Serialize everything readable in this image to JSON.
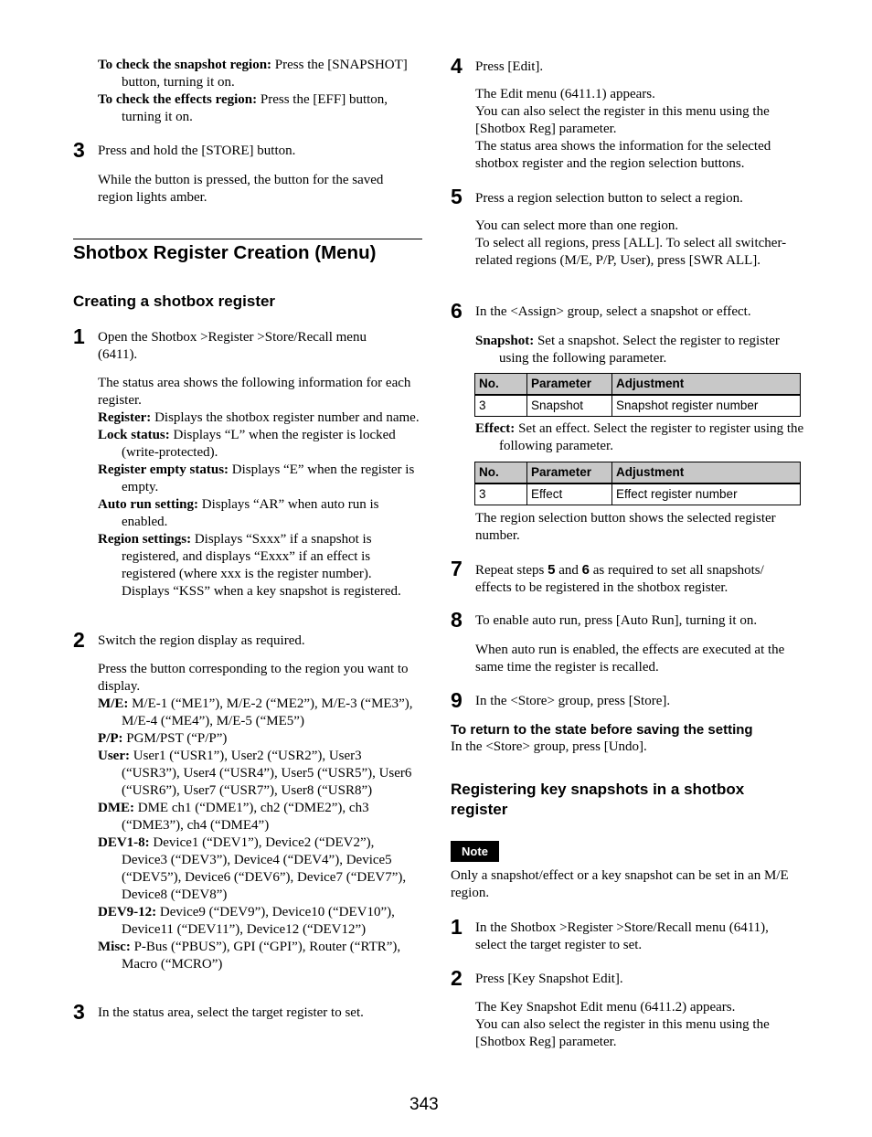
{
  "left_column": {
    "intro_items": [
      {
        "label": "To check the snapshot region:",
        "text": " Press the [SNAPSHOT] button, turning it on."
      },
      {
        "label": "To check the effects region:",
        "text": " Press the [EFF] button, turning it on."
      }
    ],
    "prev_step3": {
      "number": "3",
      "text": "Press and hold the [STORE] button.",
      "detail": "While the button is pressed, the button for the saved region lights amber."
    },
    "section_title": "Shotbox Register Creation (Menu)",
    "subsection_title": "Creating a shotbox register",
    "step1": {
      "number": "1",
      "text": "Open the Shotbox >Register >Store/Recall menu (6411).",
      "detail": "The status area shows the following information for each register.",
      "items": [
        {
          "label": "Register:",
          "text": " Displays the shotbox register number and name."
        },
        {
          "label": "Lock status:",
          "text": " Displays “L” when the register is locked (write-protected)."
        },
        {
          "label": "Register empty status:",
          "text": " Displays “E” when the register is empty."
        },
        {
          "label": "Auto run setting:",
          "text": " Displays “AR” when auto run is enabled."
        },
        {
          "label": "Region settings:",
          "text": " Displays “Sxxx” if a snapshot is registered, and displays “Exxx” if an effect is registered (where xxx is the register number). Displays “KSS” when a key snapshot is registered."
        }
      ]
    },
    "step2": {
      "number": "2",
      "text": "Switch the region display as required.",
      "detail": "Press the button corresponding to the region you want to display.",
      "items": [
        {
          "label": "M/E:",
          "text": " M/E-1 (“ME1”), M/E-2 (“ME2”), M/E-3 (“ME3”), M/E-4 (“ME4”), M/E-5 (“ME5”)"
        },
        {
          "label": "P/P:",
          "text": " PGM/PST (“P/P”)"
        },
        {
          "label": "User:",
          "text": " User1 (“USR1”), User2 (“USR2”), User3 (“USR3”), User4 (“USR4”), User5 (“USR5”), User6 (“USR6”), User7 (“USR7”), User8 (“USR8”)"
        },
        {
          "label": "DME:",
          "text": " DME ch1 (“DME1”), ch2 (“DME2”), ch3 (“DME3”), ch4 (“DME4”)"
        },
        {
          "label": "DEV1-8:",
          "text": " Device1 (“DEV1”), Device2 (“DEV2”), Device3 (“DEV3”), Device4 (“DEV4”), Device5 (“DEV5”), Device6 (“DEV6”), Device7 (“DEV7”), Device8 (“DEV8”)"
        },
        {
          "label": "DEV9-12:",
          "text": " Device9 (“DEV9”), Device10 (“DEV10”), Device11 (“DEV11”), Device12 (“DEV12”)"
        },
        {
          "label": "Misc:",
          "text": " P-Bus (“PBUS”), GPI (“GPI”), Router (“RTR”), Macro (“MCRO”)"
        }
      ]
    },
    "step3": {
      "number": "3",
      "text": "In the status area, select the target register to set."
    }
  },
  "right_column": {
    "step4": {
      "number": "4",
      "text": "Press [Edit].",
      "detail_lines": [
        "The Edit menu (6411.1) appears.",
        "You can also select the register in this menu using the [Shotbox Reg] parameter.",
        "The status area shows the information for the selected shotbox register and the region selection buttons."
      ]
    },
    "step5": {
      "number": "5",
      "text": "Press a region selection button to select a region.",
      "detail_lines": [
        "You can select more than one region.",
        "To select all regions, press [ALL]. To select all switcher-related regions (M/E, P/P, User), press [SWR ALL]."
      ]
    },
    "step6": {
      "number": "6",
      "text": "In the <Assign> group, select a snapshot or effect.",
      "snapshot": {
        "label": "Snapshot:",
        "text": " Set a snapshot. Select the register to register using the following parameter."
      },
      "snapshot_table": {
        "headers": [
          "No.",
          "Parameter",
          "Adjustment"
        ],
        "rows": [
          [
            "3",
            "Snapshot",
            "Snapshot register number"
          ]
        ]
      },
      "effect": {
        "label": "Effect:",
        "text": " Set an effect. Select the register to register using the following parameter."
      },
      "effect_table": {
        "headers": [
          "No.",
          "Parameter",
          "Adjustment"
        ],
        "rows": [
          [
            "3",
            "Effect",
            "Effect register number"
          ]
        ]
      },
      "after_text": "The region selection button shows the selected register number."
    },
    "step7": {
      "number": "7",
      "text_before": "Repeat steps ",
      "ref1": "5",
      "text_mid": " and ",
      "ref2": "6",
      "text_after": " as required to set all snapshots/ effects to be registered in the shotbox register."
    },
    "step8": {
      "number": "8",
      "text": "To enable auto run, press [Auto Run], turning it on.",
      "detail": "When auto run is enabled, the effects are executed at the same time the register is recalled."
    },
    "step9": {
      "number": "9",
      "text": "In the <Store> group, press [Store]."
    },
    "return_heading": "To return to the state before saving the setting",
    "return_text": "In the <Store> group, press [Undo].",
    "subsection_title": "Registering key snapshots in a shotbox register",
    "note_label": "Note",
    "note_text": "Only a snapshot/effect or a key snapshot can be set in an M/E region.",
    "ks_step1": {
      "number": "1",
      "text": "In the Shotbox >Register >Store/Recall menu (6411), select the target register to set."
    },
    "ks_step2": {
      "number": "2",
      "text": "Press [Key Snapshot Edit].",
      "detail_lines": [
        "The Key Snapshot Edit menu (6411.2) appears.",
        "You can also select the register in this menu using the [Shotbox Reg] parameter."
      ]
    }
  },
  "page_number": "343"
}
